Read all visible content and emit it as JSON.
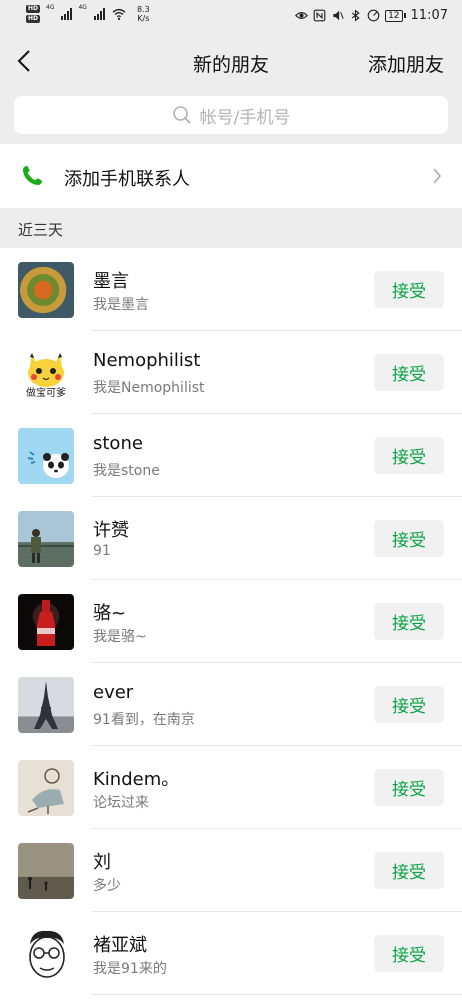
{
  "status_bar": {
    "network_type_1": "4G",
    "network_type_2": "4G",
    "net_speed_value": "8.3",
    "net_speed_unit": "K/s",
    "battery_level": "12",
    "time": "11:07"
  },
  "nav": {
    "title": "新的朋友",
    "action_label": "添加朋友"
  },
  "search": {
    "placeholder": "帐号/手机号"
  },
  "add_contacts": {
    "label": "添加手机联系人"
  },
  "section": {
    "title": "近三天"
  },
  "requests": [
    {
      "name": "墨言",
      "message": "我是墨言",
      "action": "接受"
    },
    {
      "name": "Nemophilist",
      "message": "我是Nemophilist",
      "action": "接受",
      "avatar_caption": "做宝可爹"
    },
    {
      "name": "stone",
      "message": "我是stone",
      "action": "接受"
    },
    {
      "name": "许赟",
      "message": "91",
      "action": "接受"
    },
    {
      "name": "骆~",
      "message": "我是骆~",
      "action": "接受"
    },
    {
      "name": "ever",
      "message": "91看到，在南京",
      "action": "接受"
    },
    {
      "name": "Kindem。",
      "message": "论坛过来",
      "action": "接受"
    },
    {
      "name": "刘",
      "message": "多少",
      "action": "接受"
    },
    {
      "name": "褚亚斌",
      "message": "我是91来的",
      "action": "接受"
    }
  ],
  "colors": {
    "accent_green": "#07a343",
    "background": "#ededed"
  }
}
